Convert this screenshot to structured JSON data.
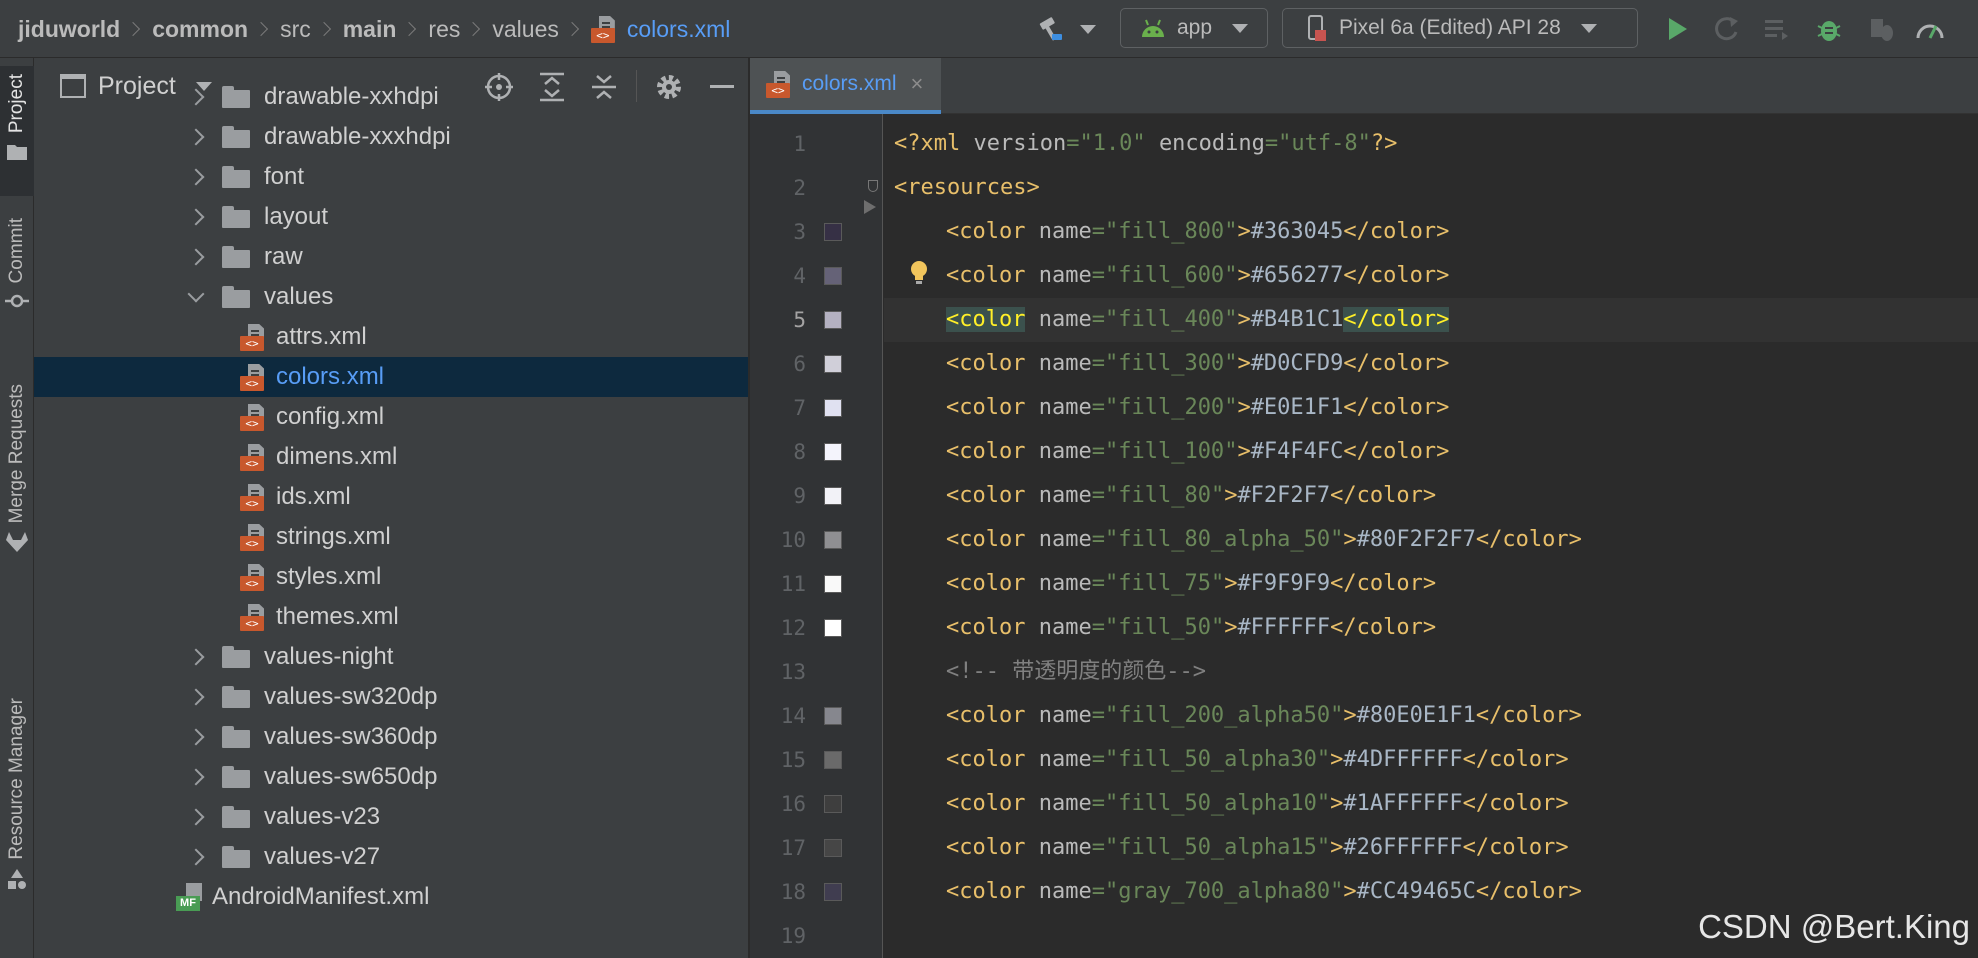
{
  "breadcrumbs": [
    {
      "label": "jiduworld",
      "bold": true
    },
    {
      "label": "common",
      "bold": true
    },
    {
      "label": "src",
      "bold": false
    },
    {
      "label": "main",
      "bold": true
    },
    {
      "label": "res",
      "bold": false
    },
    {
      "label": "values",
      "bold": false
    },
    {
      "label": "colors.xml",
      "bold": false,
      "icon": "xml-file-icon"
    }
  ],
  "toolbar": {
    "run_config": "app",
    "device": "Pixel 6a (Edited) API 28",
    "xml_tag": "<>"
  },
  "tool_strip": {
    "project": "Project",
    "commit": "Commit",
    "merge_requests": "Merge Requests",
    "resource_manager": "Resource Manager"
  },
  "project_panel": {
    "title": "Project",
    "tree": [
      {
        "label": "drawable-xxhdpi",
        "type": "folder",
        "expanded": false,
        "depth": 1
      },
      {
        "label": "drawable-xxxhdpi",
        "type": "folder",
        "expanded": false,
        "depth": 1
      },
      {
        "label": "font",
        "type": "folder",
        "expanded": false,
        "depth": 1
      },
      {
        "label": "layout",
        "type": "folder",
        "expanded": false,
        "depth": 1
      },
      {
        "label": "raw",
        "type": "folder",
        "expanded": false,
        "depth": 1
      },
      {
        "label": "values",
        "type": "folder",
        "expanded": true,
        "depth": 1
      },
      {
        "label": "attrs.xml",
        "type": "xml",
        "depth": 2
      },
      {
        "label": "colors.xml",
        "type": "xml",
        "depth": 2,
        "selected": true
      },
      {
        "label": "config.xml",
        "type": "xml",
        "depth": 2
      },
      {
        "label": "dimens.xml",
        "type": "xml",
        "depth": 2
      },
      {
        "label": "ids.xml",
        "type": "xml",
        "depth": 2
      },
      {
        "label": "strings.xml",
        "type": "xml",
        "depth": 2
      },
      {
        "label": "styles.xml",
        "type": "xml",
        "depth": 2
      },
      {
        "label": "themes.xml",
        "type": "xml",
        "depth": 2
      },
      {
        "label": "values-night",
        "type": "folder",
        "expanded": false,
        "depth": 1
      },
      {
        "label": "values-sw320dp",
        "type": "folder",
        "expanded": false,
        "depth": 1
      },
      {
        "label": "values-sw360dp",
        "type": "folder",
        "expanded": false,
        "depth": 1
      },
      {
        "label": "values-sw650dp",
        "type": "folder",
        "expanded": false,
        "depth": 1
      },
      {
        "label": "values-v23",
        "type": "folder",
        "expanded": false,
        "depth": 1
      },
      {
        "label": "values-v27",
        "type": "folder",
        "expanded": false,
        "depth": 1
      },
      {
        "label": "AndroidManifest.xml",
        "type": "manifest",
        "depth": 0
      }
    ],
    "manifest_tag": "MF"
  },
  "editor": {
    "tab_label": "colors.xml",
    "tab_close": "×",
    "current_line": 5,
    "lines": [
      {
        "n": "1",
        "kind": "decl",
        "text": "<?xml version=\"1.0\" encoding=\"utf-8\"?>"
      },
      {
        "n": "2",
        "kind": "open",
        "text": "<resources>"
      },
      {
        "n": "3",
        "kind": "color",
        "name": "fill_800",
        "value": "#363045",
        "swatch": "#363045"
      },
      {
        "n": "4",
        "kind": "color",
        "name": "fill_600",
        "value": "#656277",
        "swatch": "#656277"
      },
      {
        "n": "5",
        "kind": "color",
        "name": "fill_400",
        "value": "#B4B1C1",
        "swatch": "#B4B1C1"
      },
      {
        "n": "6",
        "kind": "color",
        "name": "fill_300",
        "value": "#D0CFD9",
        "swatch": "#D0CFD9"
      },
      {
        "n": "7",
        "kind": "color",
        "name": "fill_200",
        "value": "#E0E1F1",
        "swatch": "#E0E1F1"
      },
      {
        "n": "8",
        "kind": "color",
        "name": "fill_100",
        "value": "#F4F4FC",
        "swatch": "#F4F4FC"
      },
      {
        "n": "9",
        "kind": "color",
        "name": "fill_80",
        "value": "#F2F2F7",
        "swatch": "#F2F2F7"
      },
      {
        "n": "10",
        "kind": "color",
        "name": "fill_80_alpha_50",
        "value": "#80F2F2F7",
        "swatch": "#8f8f92"
      },
      {
        "n": "11",
        "kind": "color",
        "name": "fill_75",
        "value": "#F9F9F9",
        "swatch": "#F9F9F9"
      },
      {
        "n": "12",
        "kind": "color",
        "name": "fill_50",
        "value": "#FFFFFF",
        "swatch": "#FFFFFF"
      },
      {
        "n": "13",
        "kind": "comment",
        "text": "<!-- 带透明度的颜色-->"
      },
      {
        "n": "14",
        "kind": "color",
        "name": "fill_200_alpha50",
        "value": "#80E0E1F1",
        "swatch": "#86878e"
      },
      {
        "n": "15",
        "kind": "color",
        "name": "fill_50_alpha30",
        "value": "#4DFFFFFF",
        "swatch": "#6a6a6a"
      },
      {
        "n": "16",
        "kind": "color",
        "name": "fill_50_alpha10",
        "value": "#1AFFFFFF",
        "swatch": "#3e3e3e"
      },
      {
        "n": "17",
        "kind": "color",
        "name": "fill_50_alpha15",
        "value": "#26FFFFFF",
        "swatch": "#464646"
      },
      {
        "n": "18",
        "kind": "color",
        "name": "gray_700_alpha80",
        "value": "#CC49465C",
        "swatch": "#403d50"
      },
      {
        "n": "19",
        "kind": "blank",
        "text": ""
      }
    ]
  },
  "watermark": "CSDN @Bert.King"
}
